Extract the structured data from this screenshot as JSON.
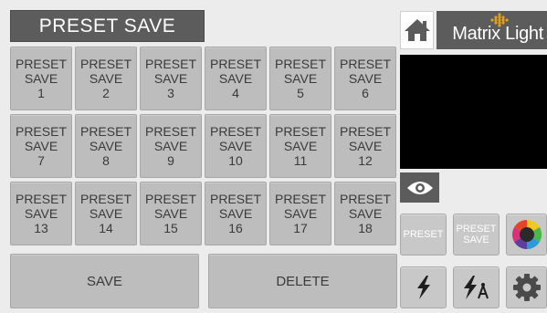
{
  "header": {
    "title": "PRESET SAVE"
  },
  "brand": {
    "logo_text": "Matrix Light"
  },
  "presets": [
    {
      "line1": "PRESET",
      "line2": "SAVE",
      "number": "1"
    },
    {
      "line1": "PRESET",
      "line2": "SAVE",
      "number": "2"
    },
    {
      "line1": "PRESET",
      "line2": "SAVE",
      "number": "3"
    },
    {
      "line1": "PRESET",
      "line2": "SAVE",
      "number": "4"
    },
    {
      "line1": "PRESET",
      "line2": "SAVE",
      "number": "5"
    },
    {
      "line1": "PRESET",
      "line2": "SAVE",
      "number": "6"
    },
    {
      "line1": "PRESET",
      "line2": "SAVE",
      "number": "7"
    },
    {
      "line1": "PRESET",
      "line2": "SAVE",
      "number": "8"
    },
    {
      "line1": "PRESET",
      "line2": "SAVE",
      "number": "9"
    },
    {
      "line1": "PRESET",
      "line2": "SAVE",
      "number": "10"
    },
    {
      "line1": "PRESET",
      "line2": "SAVE",
      "number": "11"
    },
    {
      "line1": "PRESET",
      "line2": "SAVE",
      "number": "12"
    },
    {
      "line1": "PRESET",
      "line2": "SAVE",
      "number": "13"
    },
    {
      "line1": "PRESET",
      "line2": "SAVE",
      "number": "14"
    },
    {
      "line1": "PRESET",
      "line2": "SAVE",
      "number": "15"
    },
    {
      "line1": "PRESET",
      "line2": "SAVE",
      "number": "16"
    },
    {
      "line1": "PRESET",
      "line2": "SAVE",
      "number": "17"
    },
    {
      "line1": "PRESET",
      "line2": "SAVE",
      "number": "18"
    }
  ],
  "actions": {
    "save_label": "SAVE",
    "delete_label": "DELETE"
  },
  "side_nav": {
    "preset_label": "PRESET",
    "preset_save_line1": "PRESET",
    "preset_save_line2": "SAVE"
  },
  "icons": {
    "home": "home-icon",
    "logo": "matrix-light-logo",
    "eye": "eye-icon",
    "color": "color-wheel-icon",
    "fx": "lightning-icon",
    "fx_edit": "lightning-compass-icon",
    "settings": "gear-icon"
  },
  "colors": {
    "background": "#ececec",
    "dark_panel": "#5c5c5c",
    "button": "#bdbdbd",
    "preview": "#000000",
    "logo_accent": "#e0a020"
  }
}
